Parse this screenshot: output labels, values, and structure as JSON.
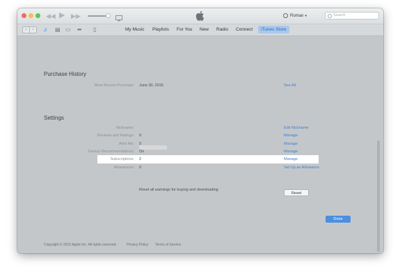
{
  "titlebar": {
    "account_name": "Roman",
    "search_placeholder": "Search"
  },
  "toolbar": {
    "tabs": [
      "My Music",
      "Playlists",
      "For You",
      "New",
      "Radio",
      "Connect",
      "iTunes Store"
    ],
    "active_tab": "iTunes Store"
  },
  "purchase_history": {
    "title": "Purchase History",
    "most_recent_label": "Most Recent Purchase:",
    "most_recent_value": "June 30, 2015",
    "see_all": "See All"
  },
  "settings": {
    "title": "Settings",
    "rows": [
      {
        "label": "Nickname:",
        "value": "",
        "link": "Edit Nickname"
      },
      {
        "label": "Reviews and Ratings:",
        "value": "9",
        "link": "Manage"
      },
      {
        "label": "Alert Me:",
        "value": "0",
        "link": "Manage"
      },
      {
        "label": "Genius Recommendations:",
        "value": "On",
        "link": "Manage"
      },
      {
        "label": "Subscriptions:",
        "value": "2",
        "link": "Manage"
      },
      {
        "label": "Allowances:",
        "value": "0",
        "link": "Set Up an Allowance"
      }
    ],
    "reset_text": "Reset all warnings for buying and downloading",
    "reset_label": "Reset"
  },
  "done_label": "Done",
  "footer": {
    "copyright": "Copyright © 2015 Apple Inc. All rights reserved.",
    "privacy": "Privacy Policy",
    "terms": "Terms of Service"
  },
  "colors": {
    "accent": "#3d7fcf",
    "active_tab_bg": "#a9c8ec",
    "done_button": "#4a8fe0",
    "close": "#ee6a5f",
    "minimize": "#f5bf4f",
    "maximize": "#61c454"
  }
}
